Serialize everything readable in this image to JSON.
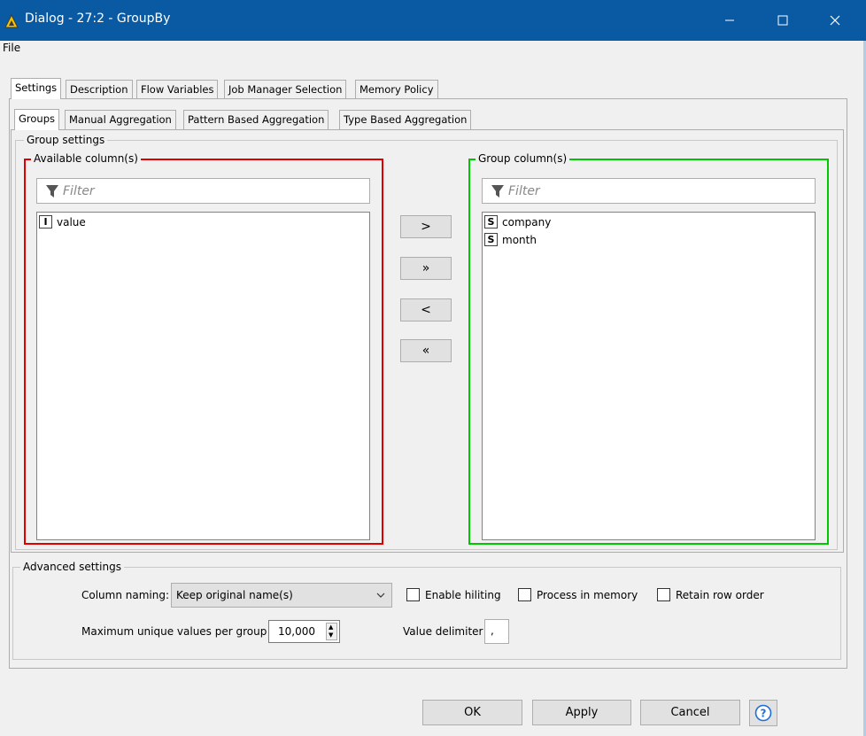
{
  "window": {
    "title": "Dialog - 27:2 - GroupBy",
    "titlebar_color": "#0a5aa3",
    "icons": [
      "knime-logo-icon",
      "minimize-icon",
      "maximize-icon",
      "close-icon"
    ]
  },
  "menubar": {
    "file": "File"
  },
  "tabs": [
    {
      "label": "Settings",
      "active": true
    },
    {
      "label": "Description",
      "active": false
    },
    {
      "label": "Flow Variables",
      "active": false
    },
    {
      "label": "Job Manager Selection",
      "active": false
    },
    {
      "label": "Memory Policy",
      "active": false
    }
  ],
  "subtabs": [
    {
      "label": "Groups",
      "active": true
    },
    {
      "label": "Manual Aggregation",
      "active": false
    },
    {
      "label": "Pattern Based Aggregation",
      "active": false
    },
    {
      "label": "Type Based Aggregation",
      "active": false
    }
  ],
  "group_settings": {
    "legend": "Group settings",
    "available": {
      "label": "Available column(s)",
      "border_color": "#e00000",
      "filter_placeholder": "Filter",
      "columns": [
        {
          "type": "I",
          "name": "value"
        }
      ]
    },
    "selected": {
      "label": "Group column(s)",
      "border_color": "#00c800",
      "filter_placeholder": "Filter",
      "columns": [
        {
          "type": "S",
          "name": "company"
        },
        {
          "type": "S",
          "name": "month"
        }
      ]
    },
    "move_buttons": {
      "add": ">",
      "add_all": "»",
      "remove": "<",
      "remove_all": "«"
    }
  },
  "advanced": {
    "legend": "Advanced settings",
    "column_naming_label": "Column naming:",
    "column_naming_value": "Keep original name(s)",
    "enable_hiliting": {
      "label": "Enable hiliting",
      "checked": false
    },
    "process_in_memory": {
      "label": "Process in memory",
      "checked": false
    },
    "retain_row_order": {
      "label": "Retain row order",
      "checked": false
    },
    "max_unique_label": "Maximum unique values per group",
    "max_unique_value": "10,000",
    "value_delimiter_label": "Value delimiter",
    "value_delimiter_value": ","
  },
  "buttons": {
    "ok": "OK",
    "apply": "Apply",
    "cancel": "Cancel",
    "help": "?"
  }
}
